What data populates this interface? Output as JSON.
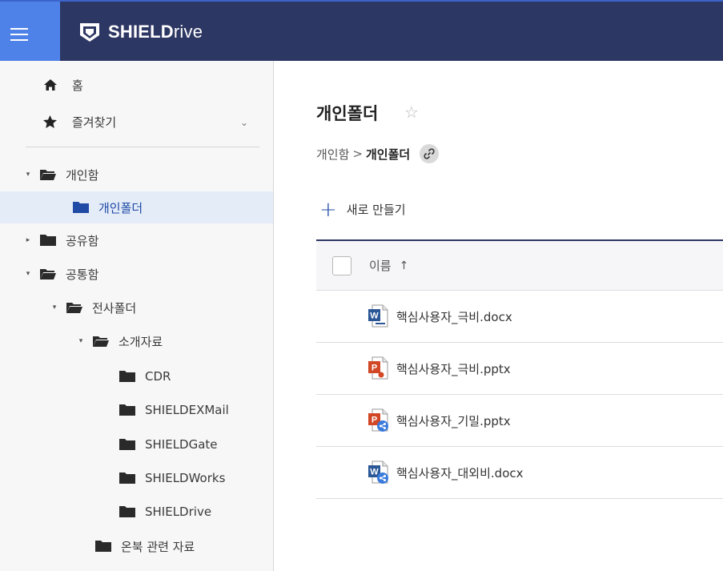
{
  "app": {
    "brand_bold": "SHIELD",
    "brand_light": "rive"
  },
  "sidebar": {
    "home": "홈",
    "favorites": "즐겨찾기",
    "tree": [
      {
        "label": "개인함"
      },
      {
        "label": "개인폴더"
      },
      {
        "label": "공유함"
      },
      {
        "label": "공통함"
      },
      {
        "label": "전사폴더"
      },
      {
        "label": "소개자료"
      },
      {
        "label": "CDR"
      },
      {
        "label": "SHIELDEXMail"
      },
      {
        "label": "SHIELDGate"
      },
      {
        "label": "SHIELDWorks"
      },
      {
        "label": "SHIELDrive"
      },
      {
        "label": "온북 관련 자료"
      }
    ]
  },
  "main": {
    "title": "개인폴더",
    "breadcrumb": {
      "root": "개인함",
      "separator": ">",
      "current": "개인폴더"
    },
    "new_button": "새로 만들기",
    "table": {
      "name_header": "이름",
      "sort_indicator": "↑",
      "files": [
        {
          "name": "핵심사용자_극비.docx",
          "type": "word",
          "shared": false
        },
        {
          "name": "핵심사용자_극비.pptx",
          "type": "powerpoint",
          "shared": false
        },
        {
          "name": "핵심사용자_기밀.pptx",
          "type": "powerpoint",
          "shared": true
        },
        {
          "name": "핵심사용자_대외비.docx",
          "type": "word",
          "shared": true
        }
      ]
    }
  },
  "colors": {
    "topbar": "#2d3763",
    "menu_button": "#4f82e8",
    "selected_row": "#e4ecf8",
    "accent": "#1f4aa6",
    "word": "#2b5797",
    "powerpoint": "#d24726",
    "share_badge": "#3a7bdc"
  }
}
